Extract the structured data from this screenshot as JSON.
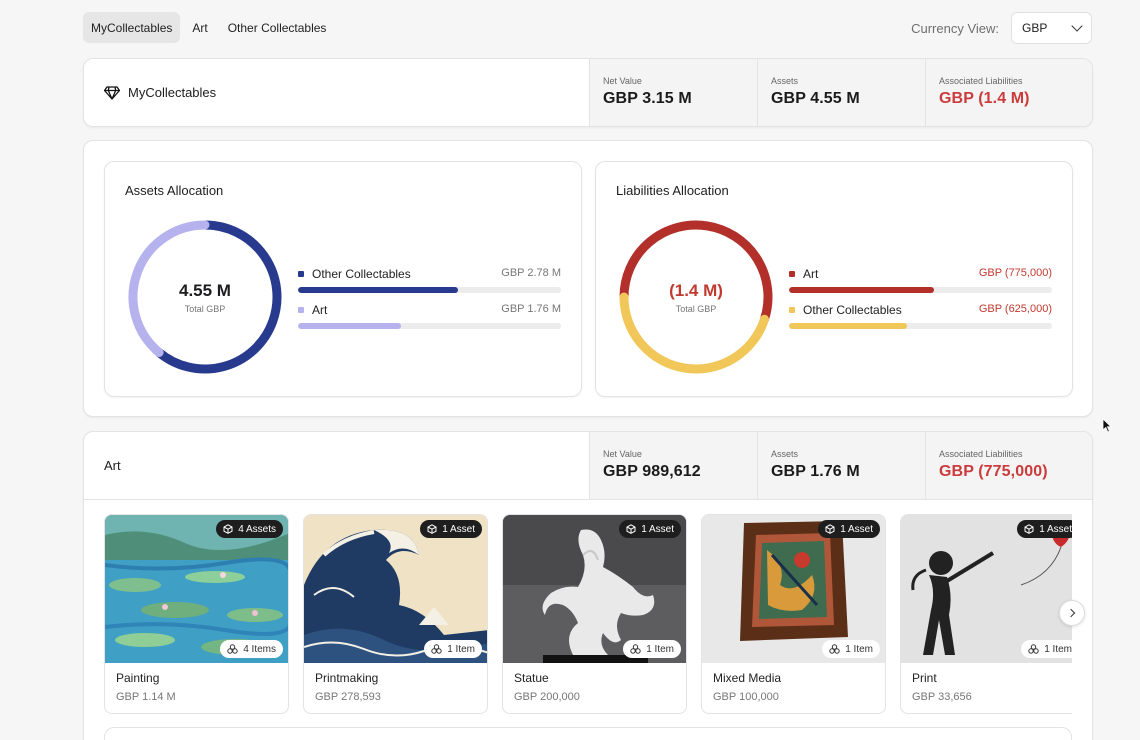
{
  "nav": {
    "tabs": [
      {
        "label": "MyCollectables",
        "active": true
      },
      {
        "label": "Art",
        "active": false
      },
      {
        "label": "Other Collectables",
        "active": false
      }
    ],
    "currency_label": "Currency View:",
    "currency_value": "GBP"
  },
  "summary": {
    "title": "MyCollectables",
    "icon": "diamond-icon",
    "stats": [
      {
        "label": "Net Value",
        "value": "GBP 3.15 M"
      },
      {
        "label": "Assets",
        "value": "GBP 4.55 M"
      },
      {
        "label": "Associated Liabilities",
        "value": "GBP (1.4 M)",
        "negative": true
      }
    ]
  },
  "assets_allocation": {
    "title": "Assets Allocation",
    "center_value": "4.55 M",
    "center_label": "Total GBP",
    "items": [
      {
        "name": "Other Collectables",
        "value": "GBP 2.78 M",
        "share": 0.61,
        "color": "#283a8e"
      },
      {
        "name": "Art",
        "value": "GBP 1.76 M",
        "share": 0.39,
        "color": "#b5b2ee"
      }
    ]
  },
  "liabilities_allocation": {
    "title": "Liabilities Allocation",
    "center_value": "(1.4 M)",
    "center_label": "Total GBP",
    "items": [
      {
        "name": "Art",
        "value": "GBP (775,000)",
        "share": 0.55,
        "color": "#b3302a"
      },
      {
        "name": "Other Collectables",
        "value": "GBP (625,000)",
        "share": 0.45,
        "color": "#f1c75a"
      }
    ]
  },
  "art_section": {
    "title": "Art",
    "stats": [
      {
        "label": "Net Value",
        "value": "GBP 989,612"
      },
      {
        "label": "Assets",
        "value": "GBP 1.76 M"
      },
      {
        "label": "Associated Liabilities",
        "value": "GBP (775,000)",
        "negative": true
      }
    ],
    "categories": [
      {
        "name": "Painting",
        "value": "GBP 1.14 M",
        "assets": "4 Assets",
        "items": "4 Items"
      },
      {
        "name": "Printmaking",
        "value": "GBP 278,593",
        "assets": "1 Asset",
        "items": "1 Item"
      },
      {
        "name": "Statue",
        "value": "GBP 200,000",
        "assets": "1 Asset",
        "items": "1 Item"
      },
      {
        "name": "Mixed Media",
        "value": "GBP 100,000",
        "assets": "1 Asset",
        "items": "1 Item"
      },
      {
        "name": "Print",
        "value": "GBP 33,656",
        "assets": "1 Asset",
        "items": "1 Item"
      }
    ]
  },
  "icons": {
    "asset_badge": "cube-icon",
    "items_badge": "three-circles-icon",
    "carousel_next": "chevron-right-icon",
    "currency_select": "chevron-down-icon"
  }
}
